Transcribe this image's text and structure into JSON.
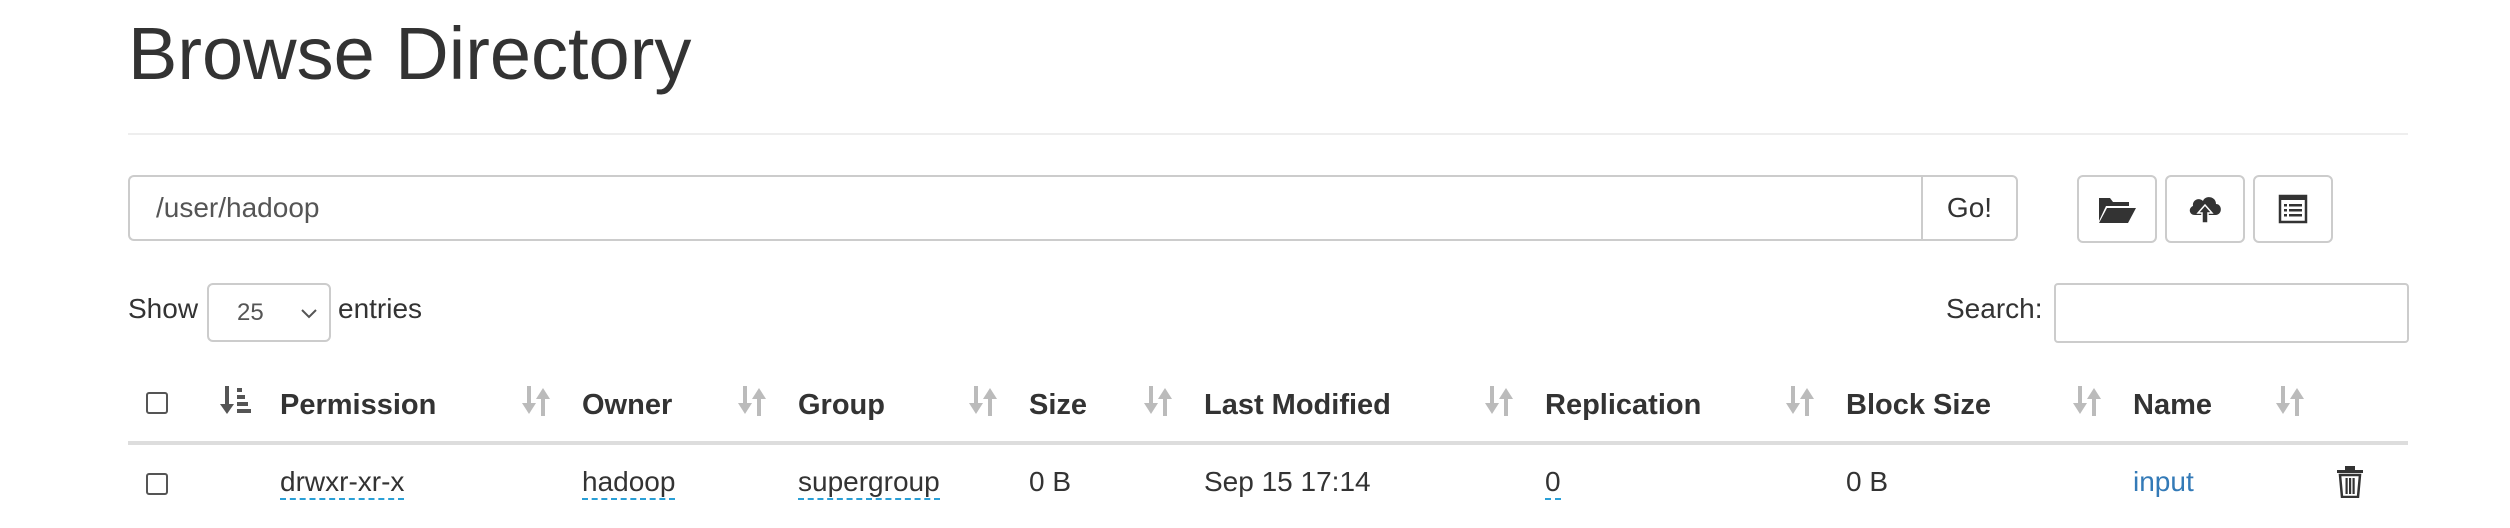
{
  "page": {
    "title": "Browse Directory"
  },
  "path_bar": {
    "value": "/user/hadoop",
    "go_label": "Go!"
  },
  "toolbar": {
    "create_dir_icon": "folder-open-icon",
    "upload_icon": "cloud-upload-icon",
    "cut_paste_icon": "list-alt-icon"
  },
  "length": {
    "show_label": "Show",
    "selected": "25",
    "entries_label": "entries"
  },
  "search": {
    "label": "Search:",
    "value": ""
  },
  "table": {
    "headers": [
      "Permission",
      "Owner",
      "Group",
      "Size",
      "Last Modified",
      "Replication",
      "Block Size",
      "Name"
    ],
    "rows": [
      {
        "permission": "drwxr-xr-x",
        "owner": "hadoop",
        "group": "supergroup",
        "size": "0 B",
        "last_modified": "Sep 15 17:14",
        "replication": "0",
        "block_size": "0 B",
        "name": "input"
      }
    ]
  },
  "colors": {
    "link": "#337ab7",
    "border": "#cccccc",
    "text": "#333333"
  }
}
